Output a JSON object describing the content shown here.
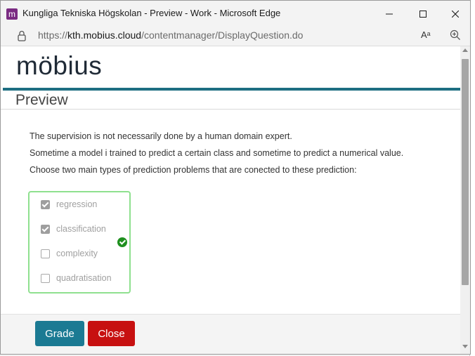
{
  "window": {
    "title": "Kungliga Tekniska Högskolan - Preview - Work - Microsoft Edge",
    "app_icon_glyph": "m",
    "app_icon_color": "#7a2b82",
    "controls": [
      "minimize-icon",
      "maximize-icon",
      "close-icon"
    ]
  },
  "address": {
    "url_prefix": "https://",
    "url_host": "kth.mobius.cloud",
    "url_path": "/contentmanager/DisplayQuestion.do",
    "read_aloud_glyph": "Aᵃ"
  },
  "page": {
    "logo_text": "möbius",
    "preview_title": "Preview",
    "accent_color": "#1d6e82",
    "question_lines": [
      "The supervision is not necessarily done by a human domain expert.",
      "Sometime a model i trained to predict a certain class and sometime to predict a numerical value.",
      "Choose two main types of prediction problems that are conected to these prediction:"
    ],
    "options": [
      {
        "label": "regression",
        "checked": true
      },
      {
        "label": "classification",
        "checked": true
      },
      {
        "label": "complexity",
        "checked": false
      },
      {
        "label": "quadratisation",
        "checked": false
      }
    ],
    "result": "correct",
    "result_color": "#1e8f1e",
    "buttons": {
      "grade": {
        "label": "Grade",
        "color": "#1b7a93"
      },
      "close": {
        "label": "Close",
        "color": "#c71010"
      }
    }
  }
}
